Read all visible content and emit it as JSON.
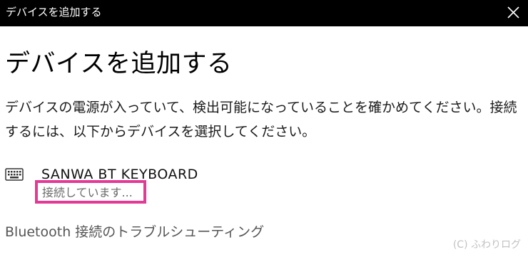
{
  "window": {
    "title": "デバイスを追加する"
  },
  "main": {
    "heading": "デバイスを追加する",
    "description": "デバイスの電源が入っていて、検出可能になっていることを確かめてください。接続するには、以下からデバイスを選択してください。"
  },
  "device": {
    "icon": "keyboard-icon",
    "name": "SANWA BT KEYBOARD",
    "status": "接続しています..."
  },
  "links": {
    "troubleshoot": "Bluetooth 接続のトラブルシューティング"
  },
  "watermark": "(C) ふわりログ",
  "colors": {
    "titlebar_bg": "#000000",
    "highlight_border": "#e33a96"
  }
}
